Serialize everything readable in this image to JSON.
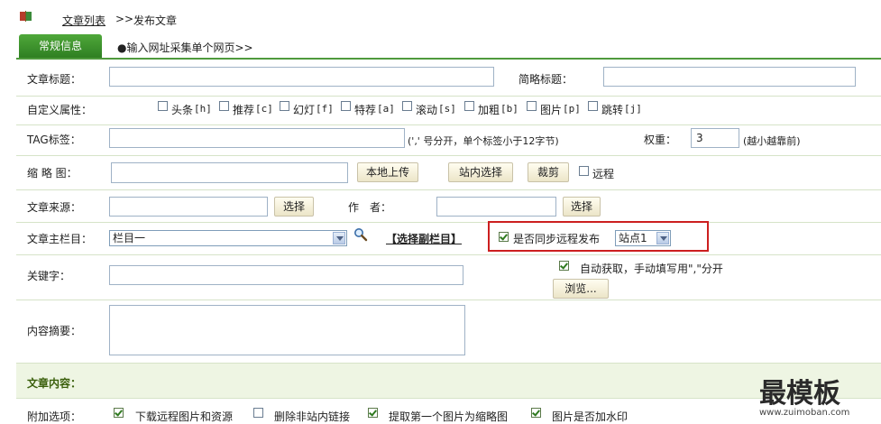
{
  "breadcrumb": {
    "list_link": "文章列表",
    "separator": ">>",
    "current": "发布文章"
  },
  "tabs": {
    "general": "常规信息",
    "collect": "●输入网址采集单个网页>>"
  },
  "form": {
    "title_label": "文章标题：",
    "short_title_label": "简略标题：",
    "custom_attr_label": "自定义属性：",
    "attributes": [
      {
        "label": "头条",
        "code": "[h]"
      },
      {
        "label": "推荐",
        "code": "[c]"
      },
      {
        "label": "幻灯",
        "code": "[f]"
      },
      {
        "label": "特荐",
        "code": "[a]"
      },
      {
        "label": "滚动",
        "code": "[s]"
      },
      {
        "label": "加粗",
        "code": "[b]"
      },
      {
        "label": "图片",
        "code": "[p]"
      },
      {
        "label": "跳转",
        "code": "[j]"
      }
    ],
    "tag_label": "TAG标签：",
    "tag_hint": "(',' 号分开，单个标签小于12字节)",
    "weight_label": "权重：",
    "weight_value": "3",
    "weight_hint": "(越小越靠前)",
    "thumb_label": "缩 略 图：",
    "upload_button": "本地上传",
    "site_select_button": "站内选择",
    "crop_button": "裁剪",
    "remote_label": "远程",
    "source_label": "文章来源：",
    "select_button": "选择",
    "author_label": "作　者：",
    "author_select_button": "选择",
    "column_label": "文章主栏目：",
    "column_value": "栏目一",
    "sub_column_link": "【选择副栏目】",
    "sync_label": "是否同步远程发布",
    "site_value": "站点1",
    "keyword_label": "关键字：",
    "auto_get_label": "自动获取，手动填写用\",\"分开",
    "browse_button": "浏览...",
    "summary_label": "内容摘要：",
    "content_section": "文章内容：",
    "extra_label": "附加选项：",
    "extra_options": [
      {
        "label": "下载远程图片和资源",
        "checked": true
      },
      {
        "label": "删除非站内链接",
        "checked": false
      },
      {
        "label": "提取第一个图片为缩略图",
        "checked": true
      },
      {
        "label": "图片是否加水印",
        "checked": true
      }
    ]
  },
  "watermark": {
    "brand": "最模板",
    "url": "www.zuimoban.com"
  },
  "colors": {
    "tab_active": "#3d8f2b",
    "label_green": "#3a5f0b",
    "highlight": "#cc1f1f"
  }
}
